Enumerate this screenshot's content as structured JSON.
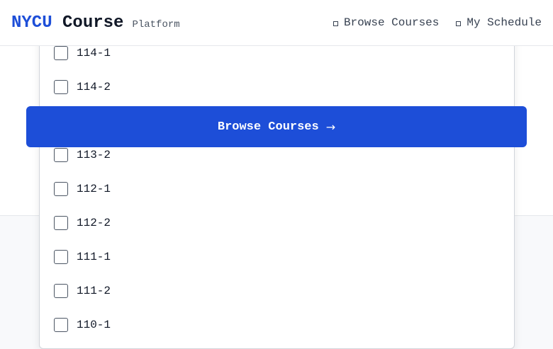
{
  "header": {
    "brand_part1": "NYCU",
    "brand_part2": "Course",
    "brand_sub": "Platform",
    "nav": [
      {
        "label": "Browse Courses",
        "icon": "square-icon"
      },
      {
        "label": "My Schedule",
        "icon": "square-icon"
      }
    ]
  },
  "semester_options": [
    {
      "label": "114-1",
      "checked": false
    },
    {
      "label": "114-2",
      "checked": false
    },
    {
      "label": "113-2",
      "checked": false
    },
    {
      "label": "112-1",
      "checked": false
    },
    {
      "label": "112-2",
      "checked": false
    },
    {
      "label": "111-1",
      "checked": false
    },
    {
      "label": "111-2",
      "checked": false
    },
    {
      "label": "110-1",
      "checked": false
    }
  ],
  "cta": {
    "label": "Browse Courses",
    "arrow": "→"
  },
  "colors": {
    "accent": "#1d4ed8",
    "page_bg": "#f8f9fb"
  }
}
